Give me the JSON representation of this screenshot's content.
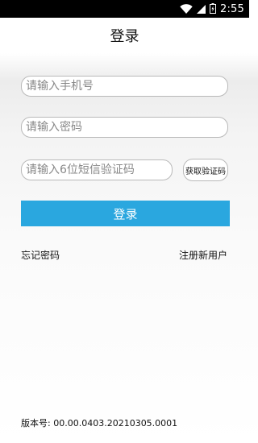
{
  "status_bar": {
    "time": "2:55",
    "icons": [
      "wifi-icon",
      "cellular-signal-icon",
      "battery-icon"
    ]
  },
  "header": {
    "title": "登录"
  },
  "form": {
    "phone_placeholder": "请输入手机号",
    "password_placeholder": "请输入密码",
    "code_placeholder": "请输入6位短信验证码",
    "get_code_label": "获取验证码",
    "login_label": "登录"
  },
  "links": {
    "forgot_password": "忘记密码",
    "register": "注册新用户"
  },
  "footer": {
    "version_label": "版本号:",
    "version_value": "00.00.0403.20210305.0001"
  },
  "colors": {
    "accent": "#2aa7df",
    "status_bar": "#000000",
    "border": "#b9b9b9"
  }
}
